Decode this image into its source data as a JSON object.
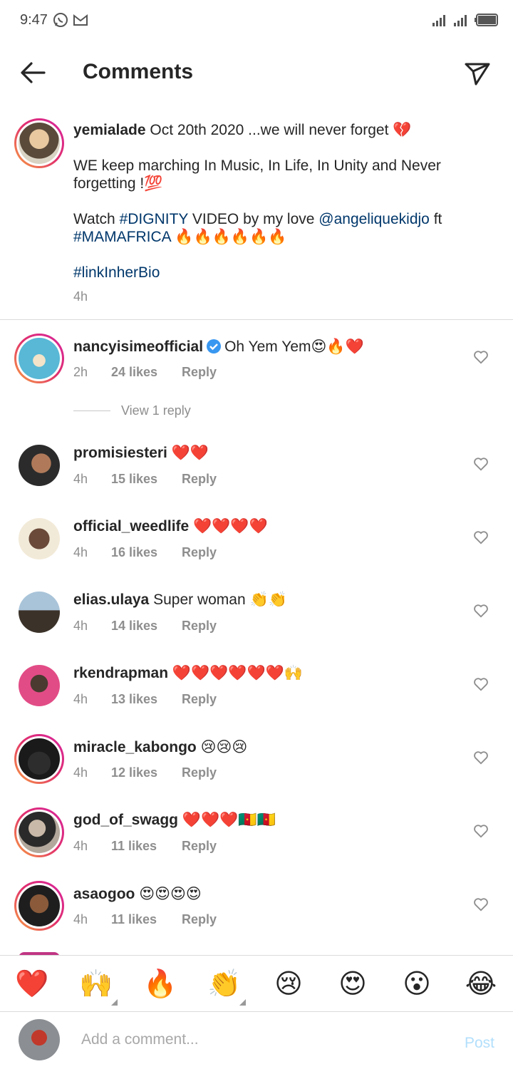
{
  "status_bar": {
    "time": "9:47",
    "left_icons": [
      "whatsapp-icon",
      "gmail-icon"
    ],
    "right_icons": [
      "signal-icon",
      "signal-icon",
      "battery-icon"
    ]
  },
  "header": {
    "title": "Comments",
    "back_icon": "arrow-left-icon",
    "share_icon": "paper-plane-icon"
  },
  "caption": {
    "username": "yemialade",
    "line1": "Oct 20th 2020 ...we will never forget 💔",
    "line2": "WE keep marching In Music, In Life, In Unity and Never forgetting !💯",
    "line3_prefix": "Watch ",
    "line3_tag1": "#DIGNITY",
    "line3_mid": " VIDEO by my love ",
    "line3_mention": "@angeliquekidjo",
    "line3_suffix": " ft",
    "line3_tag2": "#MAMAFRICA",
    "line3_end": " 🔥🔥🔥🔥🔥🔥",
    "line4_tag": "#linkInherBio",
    "time": "4h"
  },
  "view_replies": "View 1 reply",
  "comments": [
    {
      "username": "nancyisimeofficial",
      "verified": true,
      "text": "Oh Yem Yem😍🔥❤️",
      "time": "2h",
      "likes": "24 likes",
      "reply": "Reply"
    },
    {
      "username": "promisiesteri",
      "text": "❤️❤️",
      "time": "4h",
      "likes": "15 likes",
      "reply": "Reply"
    },
    {
      "username": "official_weedlife",
      "text": "❤️❤️❤️❤️",
      "time": "4h",
      "likes": "16 likes",
      "reply": "Reply"
    },
    {
      "username": "elias.ulaya",
      "text": "Super woman 👏👏",
      "time": "4h",
      "likes": "14 likes",
      "reply": "Reply"
    },
    {
      "username": "rkendrapman",
      "text": "❤️❤️❤️❤️❤️❤️🙌",
      "time": "4h",
      "likes": "13 likes",
      "reply": "Reply"
    },
    {
      "username": "miracle_kabongo",
      "text": "😢😢😢",
      "time": "4h",
      "likes": "12 likes",
      "reply": "Reply"
    },
    {
      "username": "god_of_swagg",
      "text": "❤️❤️❤️🇨🇲🇨🇲",
      "time": "4h",
      "likes": "11 likes",
      "reply": "Reply"
    },
    {
      "username": "asaogoo",
      "text": "😍😍😍😍",
      "time": "4h",
      "likes": "11 likes",
      "reply": "Reply"
    }
  ],
  "emoji_bar": [
    "❤️",
    "🙌",
    "🔥",
    "👏",
    "😢",
    "😍",
    "😮",
    "😂"
  ],
  "composer": {
    "placeholder": "Add a comment...",
    "post_label": "Post"
  },
  "colors": {
    "link": "#00376b",
    "meta": "#8e8e8e",
    "post_disabled": "#b2dffc",
    "ring_start": "#f9a33f",
    "ring_end": "#d6249f",
    "verified": "#3897f0"
  }
}
